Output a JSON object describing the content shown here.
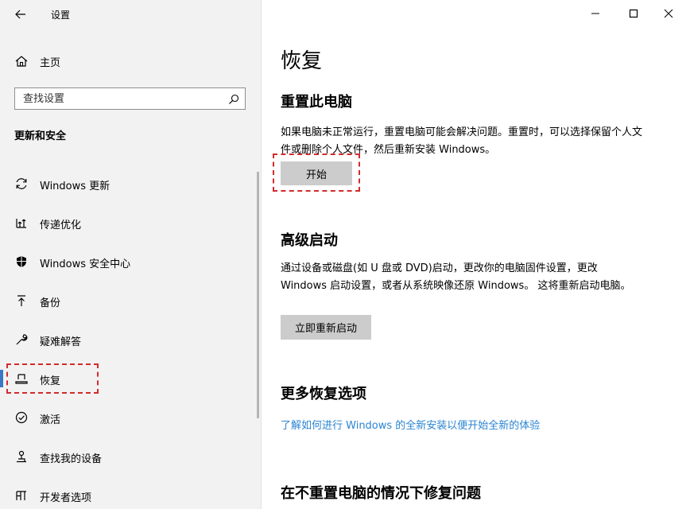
{
  "window": {
    "title": "设置"
  },
  "sidebar": {
    "home_label": "主页",
    "search_placeholder": "查找设置",
    "section_title": "更新和安全",
    "items": [
      {
        "label": "Windows 更新",
        "icon": "sync-icon"
      },
      {
        "label": "传递优化",
        "icon": "delivery-optimization-icon"
      },
      {
        "label": "Windows 安全中心",
        "icon": "shield-icon"
      },
      {
        "label": "备份",
        "icon": "backup-icon"
      },
      {
        "label": "疑难解答",
        "icon": "wrench-icon"
      },
      {
        "label": "恢复",
        "icon": "recovery-icon",
        "selected": true
      },
      {
        "label": "激活",
        "icon": "check-circle-icon"
      },
      {
        "label": "查找我的设备",
        "icon": "find-device-icon"
      },
      {
        "label": "开发者选项",
        "icon": "developer-icon"
      }
    ]
  },
  "main": {
    "title": "恢复",
    "reset": {
      "heading": "重置此电脑",
      "description": "如果电脑未正常运行，重置电脑可能会解决问题。重置时，可以选择保留个人文件或删除个人文件，然后重新安装 Windows。",
      "button": "开始"
    },
    "advanced": {
      "heading": "高级启动",
      "description": "通过设备或磁盘(如 U 盘或 DVD)启动，更改你的电脑固件设置，更改 Windows 启动设置，或者从系统映像还原 Windows。 这将重新启动电脑。",
      "button": "立即重新启动"
    },
    "more": {
      "heading": "更多恢复选项",
      "link": "了解如何进行 Windows 的全新安装以便开始全新的体验"
    },
    "fix": {
      "heading": "在不重置电脑的情况下修复问题"
    }
  },
  "colors": {
    "accent": "#3a78c4",
    "link": "#2a84d2",
    "highlight": "#d32b2b",
    "sidebar_bg": "#f2f2f2",
    "button_bg": "#cccccc"
  }
}
